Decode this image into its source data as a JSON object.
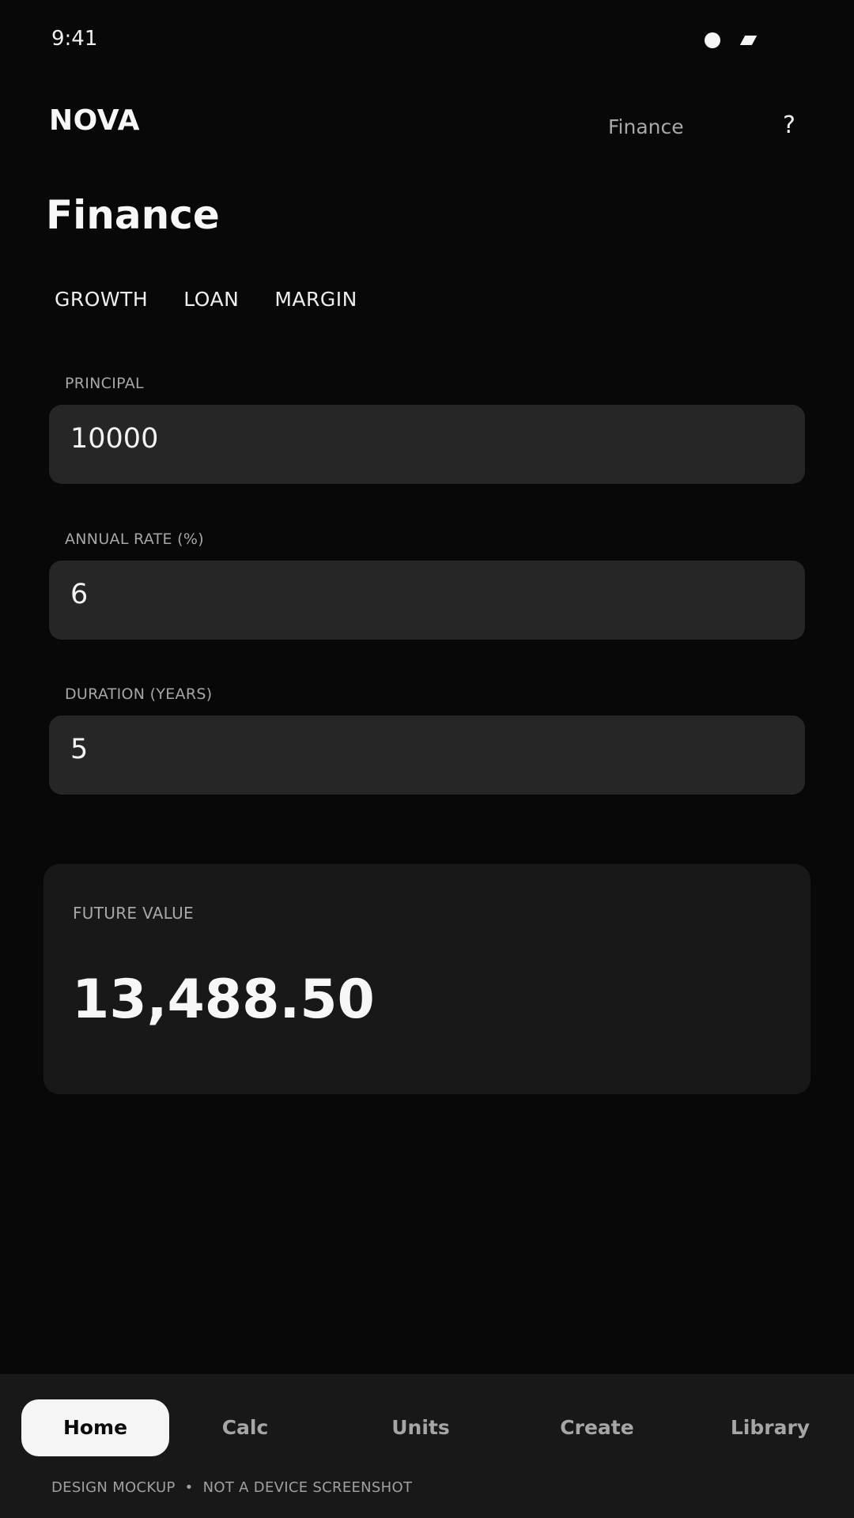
{
  "status_bar": {
    "time": "9:41"
  },
  "header": {
    "brand": "NOVA",
    "section": "Finance",
    "help_label": "?"
  },
  "page": {
    "title": "Finance"
  },
  "tabs": [
    {
      "label": "GROWTH"
    },
    {
      "label": "LOAN"
    },
    {
      "label": "MARGIN"
    }
  ],
  "fields": {
    "principal": {
      "label": "PRINCIPAL",
      "value": "10000"
    },
    "annual_rate": {
      "label": "ANNUAL RATE (%)",
      "value": "6"
    },
    "duration": {
      "label": "DURATION (YEARS)",
      "value": "5"
    }
  },
  "result": {
    "label": "FUTURE VALUE",
    "value": "13,488.50"
  },
  "bottom_nav": {
    "items": [
      {
        "label": "Home"
      },
      {
        "label": "Calc"
      },
      {
        "label": "Units"
      },
      {
        "label": "Create"
      },
      {
        "label": "Library"
      }
    ],
    "active": "Home"
  },
  "footer": {
    "note": "DESIGN MOCKUP  •  NOT A DEVICE SCREENSHOT"
  },
  "colors": {
    "background": "#080808",
    "surface": "#262626",
    "card": "#181818",
    "active_nav": "#f5f5f5"
  }
}
